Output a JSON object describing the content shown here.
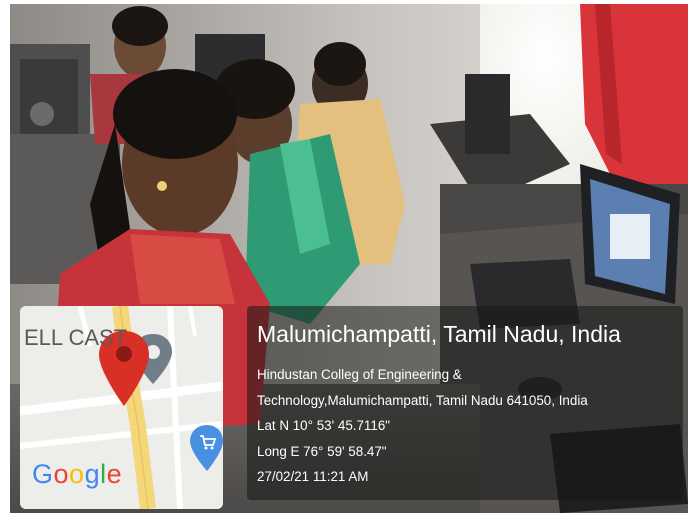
{
  "map": {
    "road_label": "ELL CAST",
    "logo_letters": [
      {
        "ch": "G",
        "color": "#4285F4"
      },
      {
        "ch": "o",
        "color": "#EA4335"
      },
      {
        "ch": "o",
        "color": "#FBBC05"
      },
      {
        "ch": "g",
        "color": "#4285F4"
      },
      {
        "ch": "l",
        "color": "#34A853"
      },
      {
        "ch": "e",
        "color": "#EA4335"
      }
    ],
    "pin_icon": "location-pin-icon",
    "shopping_icon": "shopping-cart-icon"
  },
  "info": {
    "title": "Malumichampatti, Tamil Nadu, India",
    "address_line1": "Hindustan Colleg of Engineering &",
    "address_line2": "Technology,Malumichampatti, Tamil Nadu 641050, India",
    "lat": "Lat N 10° 53' 45.7116\"",
    "long": "Long E 76° 59' 58.47\"",
    "timestamp": "27/02/21 11:21 AM"
  },
  "colors": {
    "pin_red": "#D93025",
    "pin_grey": "#707E8A",
    "cart_blue": "#4A90E2",
    "road_yellow": "#F3D77A"
  }
}
